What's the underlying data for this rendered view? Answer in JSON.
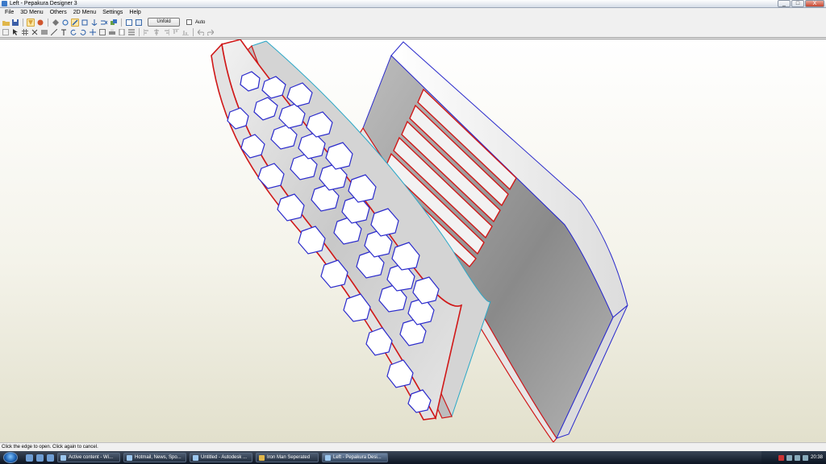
{
  "window": {
    "title": "Left - Pepakura Designer 3",
    "controls": [
      "_",
      "□",
      "X"
    ]
  },
  "menu": [
    "File",
    "3D Menu",
    "Others",
    "2D Menu",
    "Settings",
    "Help"
  ],
  "toolbar": {
    "unfold_label": "Unfold",
    "auto_label": "Auto"
  },
  "status": {
    "text": "Click the edge to open. Click again to cancel."
  },
  "taskbar": {
    "tasks": [
      {
        "label": "Active content - Wi..."
      },
      {
        "label": "Hotmail, News, Spo..."
      },
      {
        "label": "Untitled - Autodesk ..."
      },
      {
        "label": "Iron Man Seperated"
      },
      {
        "label": "Left - Pepakura Desi..."
      }
    ],
    "clock": "20:38"
  },
  "colors": {
    "edge_red": "#d01818",
    "edge_blue": "#2a2acc",
    "panel_grey": "#c7c7c7"
  }
}
